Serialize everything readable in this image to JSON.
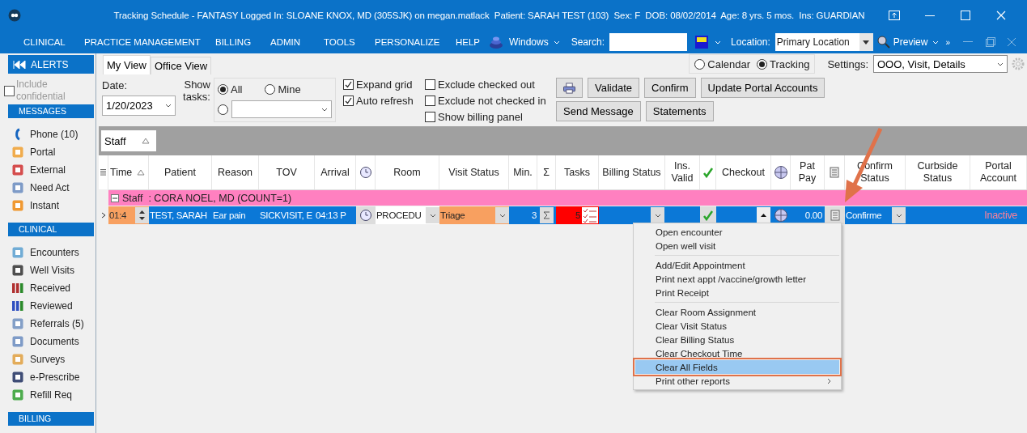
{
  "window": {
    "title": "Tracking Schedule - FANTASY Logged In: SLOANE KNOX, MD (305SJK) on megan.matlack  Patient: SARAH TEST (103)  Sex: F  DOB: 08/02/2014  Age: 8 yrs. 5 mos.  Ins: GUARDIAN"
  },
  "menu_bar": {
    "items": [
      "CLINICAL",
      "PRACTICE MANAGEMENT",
      "BILLING",
      "ADMIN",
      "TOOLS",
      "PERSONALIZE",
      "HELP"
    ],
    "windows": "Windows",
    "search_label": "Search:",
    "location_label": "Location:",
    "location": "Primary Location",
    "preview": "Preview",
    "overflow": "»"
  },
  "sidebar": {
    "alerts": "ALERTS",
    "include_confidential": {
      "label": "Include confidential",
      "checked": false,
      "disabled": true
    },
    "sections": [
      {
        "title": "MESSAGES",
        "items": [
          "Phone (10)",
          "Portal",
          "External",
          "Need Act",
          "Instant"
        ]
      },
      {
        "title": "CLINICAL",
        "items": [
          "Encounters",
          "Well Visits",
          "Received",
          "Reviewed",
          "Referrals (5)",
          "Documents",
          "Surveys",
          "e-Prescribe",
          "Refill Req"
        ]
      },
      {
        "title": "BILLING"
      }
    ]
  },
  "tabs": [
    {
      "label": "My View",
      "selected": true
    },
    {
      "label": "Office View",
      "selected": false
    }
  ],
  "view_mode": [
    {
      "label": "Calendar",
      "selected": false
    },
    {
      "label": "Tracking",
      "selected": true
    }
  ],
  "settings": {
    "label": "Settings:",
    "value": "OOO, Visit, Details"
  },
  "filters": {
    "date_label": "Date:",
    "date": "1/20/2023",
    "show_tasks_label": "Show tasks:",
    "task_options": [
      {
        "label": "All",
        "selected": true
      },
      {
        "label": "Mine",
        "selected": false
      }
    ],
    "task_other": {
      "selected": false
    },
    "checkbox_columns": [
      [
        {
          "label": "Expand grid",
          "checked": true
        },
        {
          "label": "Auto refresh",
          "checked": true
        }
      ],
      [
        {
          "label": "Exclude checked out",
          "checked": false
        },
        {
          "label": "Exclude not checked in",
          "checked": false
        },
        {
          "label": "Show billing panel",
          "checked": false
        }
      ]
    ]
  },
  "button_rows": [
    [
      {
        "kind": "print"
      },
      {
        "kind": "text",
        "label": "Validate"
      },
      {
        "kind": "text",
        "label": "Confirm"
      },
      {
        "kind": "text",
        "label": "Update Portal Accounts"
      }
    ],
    [
      {
        "kind": "text",
        "label": "Send Message"
      },
      {
        "kind": "text",
        "label": "Statements"
      }
    ]
  ],
  "group_by": {
    "label": "Staff"
  },
  "grid": {
    "columns": [
      {
        "kind": "grip"
      },
      {
        "kind": "text",
        "label": "Time",
        "sorted": true
      },
      {
        "kind": "text",
        "label": "Patient"
      },
      {
        "kind": "text",
        "label": "Reason"
      },
      {
        "kind": "text",
        "label": "TOV"
      },
      {
        "kind": "text",
        "label": "Arrival"
      },
      {
        "kind": "clock"
      },
      {
        "kind": "text",
        "label": "Room"
      },
      {
        "kind": "text",
        "label": "Visit Status"
      },
      {
        "kind": "text",
        "label": "Min."
      },
      {
        "kind": "text",
        "label": "Σ"
      },
      {
        "kind": "text",
        "label": "Tasks"
      },
      {
        "kind": "text",
        "label": "Billing Status"
      },
      {
        "kind": "text",
        "label": "Ins. Valid"
      },
      {
        "kind": "check"
      },
      {
        "kind": "text",
        "label": "Checkout"
      },
      {
        "kind": "globe"
      },
      {
        "kind": "text",
        "label": "Pat Pay"
      },
      {
        "kind": "receipt"
      },
      {
        "kind": "text",
        "label": "Confirm Status"
      },
      {
        "kind": "text",
        "label": "Curbside Status"
      },
      {
        "kind": "text",
        "label": "Portal Account"
      }
    ],
    "groups": [
      {
        "label": "Staff  : CORA NOEL, MD (COUNT=1)",
        "expanded": true,
        "rows": [
          {
            "selected": true,
            "time": "01:4",
            "patient": "TEST, SARAH",
            "reason": "Ear pain",
            "tov": "SICKVISIT, E",
            "arrival": "04:13 P",
            "room": "PROCEDU",
            "visit_status": "Triage",
            "min": "3",
            "tasks": "5",
            "ins_valid": true,
            "pat_pay": "0.00",
            "confirm_status": "Confirme",
            "portal_account": "Inactive"
          }
        ]
      }
    ]
  },
  "context_menu": {
    "groups": [
      [
        {
          "label": "Open encounter",
          "selected": false
        },
        {
          "label": "Open well visit",
          "selected": false
        }
      ],
      [
        {
          "label": "Add/Edit Appointment",
          "selected": false
        },
        {
          "label": "Print next appt /vaccine/growth letter",
          "selected": false
        },
        {
          "label": "Print Receipt",
          "selected": false
        }
      ],
      [
        {
          "label": "Clear Room Assignment",
          "selected": false
        },
        {
          "label": "Clear Visit Status",
          "selected": false
        },
        {
          "label": "Clear Billing Status",
          "selected": false
        },
        {
          "label": "Clear Checkout Time",
          "selected": false
        },
        {
          "label": "Clear All Fields",
          "selected": true,
          "outlined": true
        },
        {
          "label": "Print other reports",
          "selected": false,
          "submenu": true
        }
      ]
    ]
  }
}
